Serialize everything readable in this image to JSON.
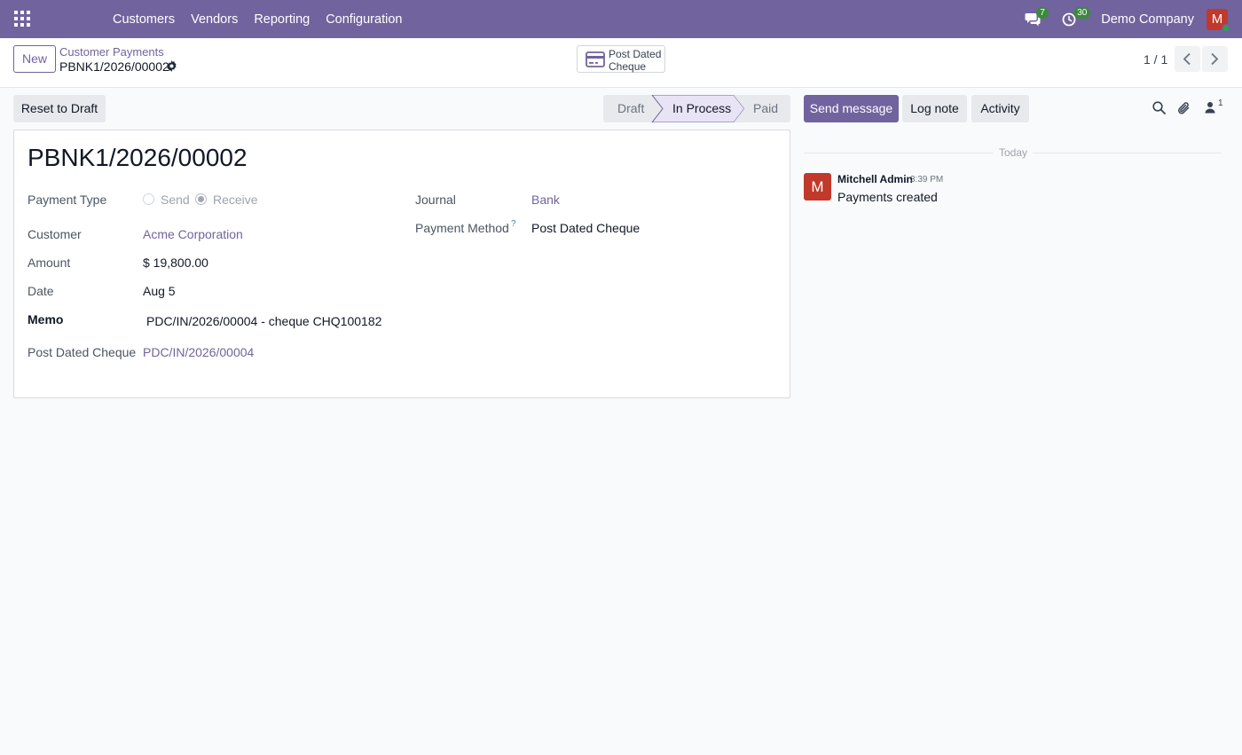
{
  "navbar": {
    "menu": [
      "Customers",
      "Vendors",
      "Reporting",
      "Configuration"
    ],
    "messages_count": "7",
    "activities_count": "30",
    "company": "Demo Company",
    "user_initial": "M"
  },
  "control_panel": {
    "new_label": "New",
    "breadcrumb_parent": "Customer Payments",
    "breadcrumb_current": "PBNK1/2026/00002",
    "smart_button_line1": "Post Dated",
    "smart_button_line2": "Cheque",
    "pager": "1 / 1"
  },
  "actions": {
    "reset_label": "Reset to Draft"
  },
  "statusbar": {
    "stages": [
      "Draft",
      "In Process",
      "Paid"
    ],
    "active": "In Process"
  },
  "form": {
    "title": "PBNK1/2026/00002",
    "payment_type_label": "Payment Type",
    "payment_type_options": [
      "Send",
      "Receive"
    ],
    "payment_type_value": "Receive",
    "customer_label": "Customer",
    "customer_value": "Acme Corporation",
    "amount_label": "Amount",
    "amount_value": "$ 19,800.00",
    "date_label": "Date",
    "date_value": "Aug 5",
    "memo_label": "Memo",
    "memo_value": "PDC/IN/2026/00004 - cheque CHQ100182",
    "pdc_label": "Post Dated Cheque",
    "pdc_value": "PDC/IN/2026/00004",
    "journal_label": "Journal",
    "journal_value": "Bank",
    "payment_method_label": "Payment Method",
    "payment_method_help": "?",
    "payment_method_value": "Post Dated Cheque"
  },
  "chatter": {
    "send_message_label": "Send message",
    "log_note_label": "Log note",
    "activity_label": "Activity",
    "follower_count": "1",
    "date_separator": "Today",
    "messages": [
      {
        "author": "Mitchell Admin",
        "time": "3:39 PM",
        "avatar_initial": "M",
        "body": "Payments created"
      }
    ]
  },
  "colors": {
    "brand": "#71639e",
    "avatar": "#c0392b",
    "badge": "#3a8a3c"
  }
}
